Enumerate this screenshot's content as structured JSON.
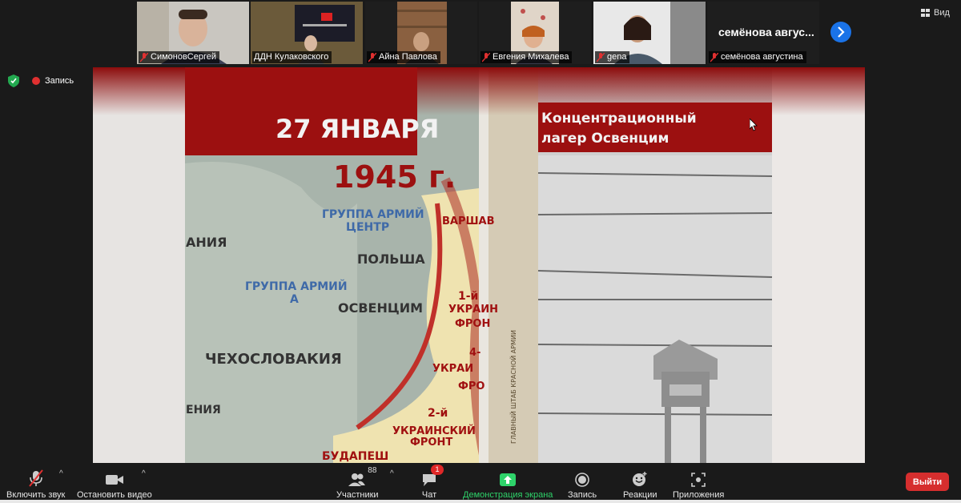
{
  "view_button": "Вид",
  "participants": [
    {
      "name": "СимоновСергей",
      "muted": true
    },
    {
      "name": "ДДН Кулаковского",
      "muted": false,
      "active": true
    },
    {
      "name": "Айна  Павлова",
      "muted": true
    },
    {
      "name": "Евгения Михалева",
      "muted": true
    },
    {
      "name": "gena",
      "muted": true
    },
    {
      "name": "семёнова августина",
      "muted": true
    }
  ],
  "nocam_tile_title": "семёнова  авгус...",
  "recording_label": "Запись",
  "shared_screen": {
    "date_line1": "27 ЯНВАРЯ",
    "date_line2": "1945 г.",
    "camp_title_line1": "Концентрационный",
    "camp_title_line2": "лагер Освенцим",
    "map_labels": [
      "ГРУППА АРМИЙ",
      "ЦЕНТР",
      "ПОЛЬША",
      "ГРУППА АРМИЙ",
      "А",
      "ОСВЕНЦИМ",
      "ЧЕХОСЛОВАКИЯ",
      "АНИЯ",
      "ВАРШАВ",
      "1-й",
      "УКРАИН",
      "ФРОН",
      "4-",
      "УКРАИ",
      "ФРО",
      "2-й",
      "УКРАИНСКИЙ",
      "ФРОНТ",
      "БУДАПЕШ",
      "ЕНИЯ"
    ],
    "book_spine_text": "ГЛАВНЫЙ ШТАБ КРАСНОЙ АРМИИ"
  },
  "toolbar": {
    "unmute": "Включить звук",
    "stop_video": "Остановить видео",
    "participants": "Участники",
    "participants_count": "88",
    "chat": "Чат",
    "chat_badge": "1",
    "share_screen": "Демонстрация экрана",
    "record": "Запись",
    "reactions": "Реакции",
    "apps": "Приложения",
    "leave": "Выйти"
  },
  "colors": {
    "accent_blue": "#1a73e8",
    "share_green": "#2ed36a",
    "leave_red": "#d62e2e",
    "banner_red": "#9c1010"
  }
}
